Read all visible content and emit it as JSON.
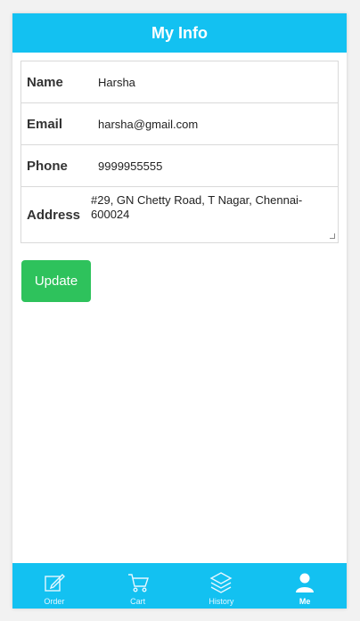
{
  "header": {
    "title": "My Info"
  },
  "form": {
    "name": {
      "label": "Name",
      "value": "Harsha"
    },
    "email": {
      "label": "Email",
      "value": "harsha@gmail.com"
    },
    "phone": {
      "label": "Phone",
      "value": "9999955555"
    },
    "address": {
      "label": "Address",
      "value": "#29, GN Chetty Road, T Nagar, Chennai-600024"
    }
  },
  "update_button": {
    "label": "Update"
  },
  "tabbar": {
    "items": [
      {
        "label": "Order",
        "icon": "order-edit-icon"
      },
      {
        "label": "Cart",
        "icon": "cart-icon"
      },
      {
        "label": "History",
        "icon": "layers-icon"
      },
      {
        "label": "Me",
        "icon": "user-icon",
        "active": true
      }
    ]
  },
  "colors": {
    "primary": "#13c1f1",
    "update": "#2ec25c"
  }
}
